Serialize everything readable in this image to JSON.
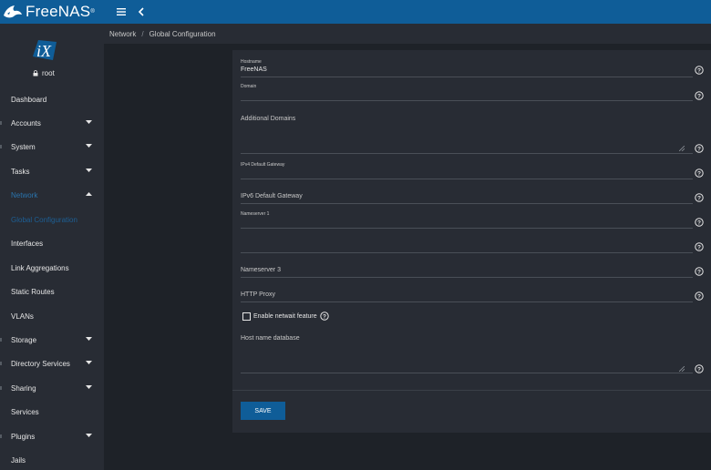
{
  "app": {
    "brand": "FreeNAS",
    "trademark": "®"
  },
  "user": {
    "name": "root"
  },
  "breadcrumb": {
    "parent": "Network",
    "separator": "/",
    "current": "Global Configuration"
  },
  "sidebar": {
    "items": [
      {
        "label": "Dashboard",
        "has_chevron": false
      },
      {
        "label": "Accounts",
        "has_chevron": true
      },
      {
        "label": "System",
        "has_chevron": true
      },
      {
        "label": "Tasks",
        "has_chevron": true
      },
      {
        "label": "Network",
        "has_chevron": true,
        "expanded": true
      },
      {
        "label": "Global Configuration",
        "has_chevron": false
      },
      {
        "label": "Interfaces",
        "has_chevron": false
      },
      {
        "label": "Link Aggregations",
        "has_chevron": false
      },
      {
        "label": "Static Routes",
        "has_chevron": false
      },
      {
        "label": "VLANs",
        "has_chevron": false
      },
      {
        "label": "Storage",
        "has_chevron": true
      },
      {
        "label": "Directory Services",
        "has_chevron": true
      },
      {
        "label": "Sharing",
        "has_chevron": true
      },
      {
        "label": "Services",
        "has_chevron": false
      },
      {
        "label": "Plugins",
        "has_chevron": true
      },
      {
        "label": "Jails",
        "has_chevron": false
      }
    ]
  },
  "form": {
    "hostname": {
      "label": "Hostname",
      "value": "FreeNAS"
    },
    "domain": {
      "label": "Domain",
      "value": ""
    },
    "additional_domains": {
      "label": "Additional Domains",
      "value": ""
    },
    "ipv4_gateway": {
      "label": "IPv4 Default Gateway",
      "value": ""
    },
    "ipv6_gateway": {
      "label": "IPv6 Default Gateway",
      "value": ""
    },
    "nameserver1": {
      "label": "Nameserver 1",
      "value": ""
    },
    "nameserver2": {
      "label": "",
      "value": ""
    },
    "nameserver3": {
      "label": "Nameserver 3",
      "value": ""
    },
    "http_proxy": {
      "label": "HTTP Proxy",
      "value": ""
    },
    "netwait": {
      "label": "Enable netwait feature",
      "checked": false
    },
    "host_db": {
      "label": "Host name database",
      "value": ""
    },
    "save_label": "SAVE"
  },
  "colors": {
    "topbar": "#0f5d98",
    "sidebar": "#282c34",
    "background": "#1e2228",
    "active_nav": "#2a74ad"
  }
}
